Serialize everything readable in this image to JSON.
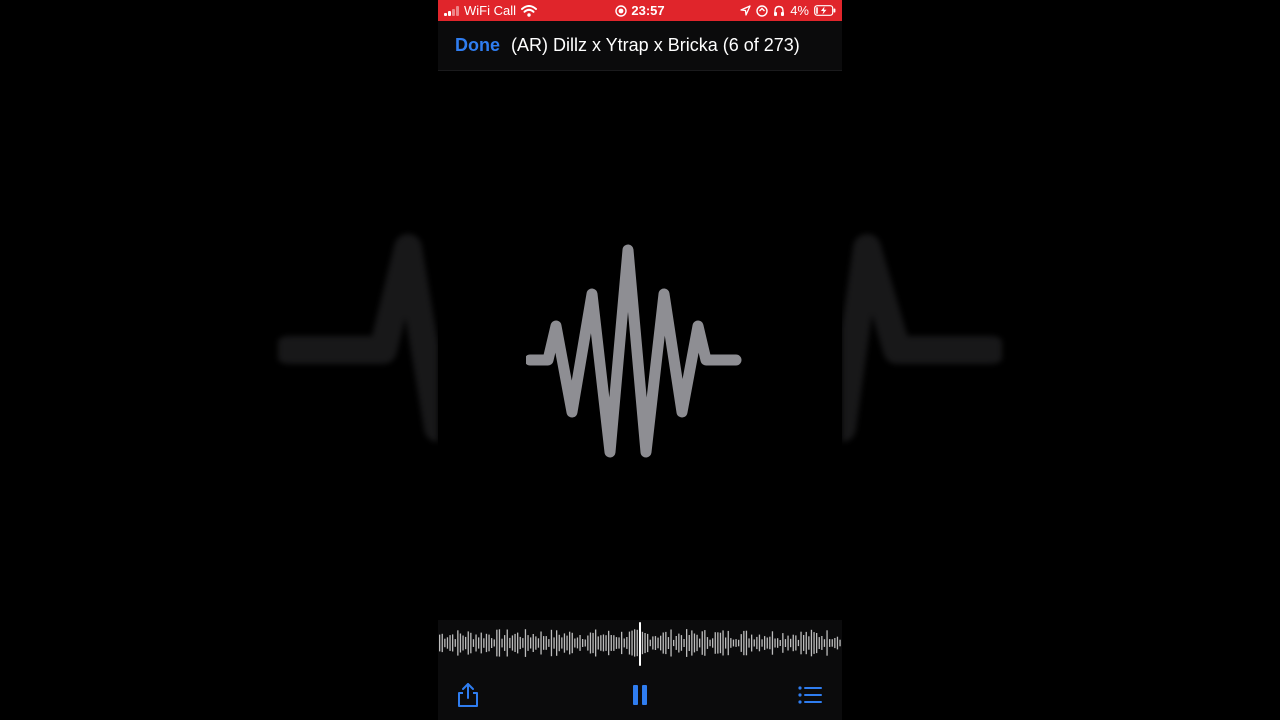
{
  "status_bar": {
    "carrier": "WiFi Call",
    "time": "23:57",
    "battery": "4%"
  },
  "nav": {
    "done_label": "Done",
    "title": "(AR) Dillz x Ytrap x Bricka (6 of 273)"
  },
  "playback": {
    "progress": 0.5,
    "state": "playing"
  },
  "colors": {
    "status_bar_bg": "#e0252b",
    "accent": "#2f7df0",
    "waveform_icon": "#8e8e93",
    "scrubber_bars": "#bdbdbd"
  },
  "icons": {
    "wifi": "wifi-icon",
    "recording": "screen-recording-icon",
    "location": "location-arrow-icon",
    "headphones": "headphones-icon",
    "battery": "battery-charging-icon",
    "share": "share-icon",
    "pause": "pause-icon",
    "list": "list-icon",
    "artwork": "audio-waveform-icon"
  }
}
